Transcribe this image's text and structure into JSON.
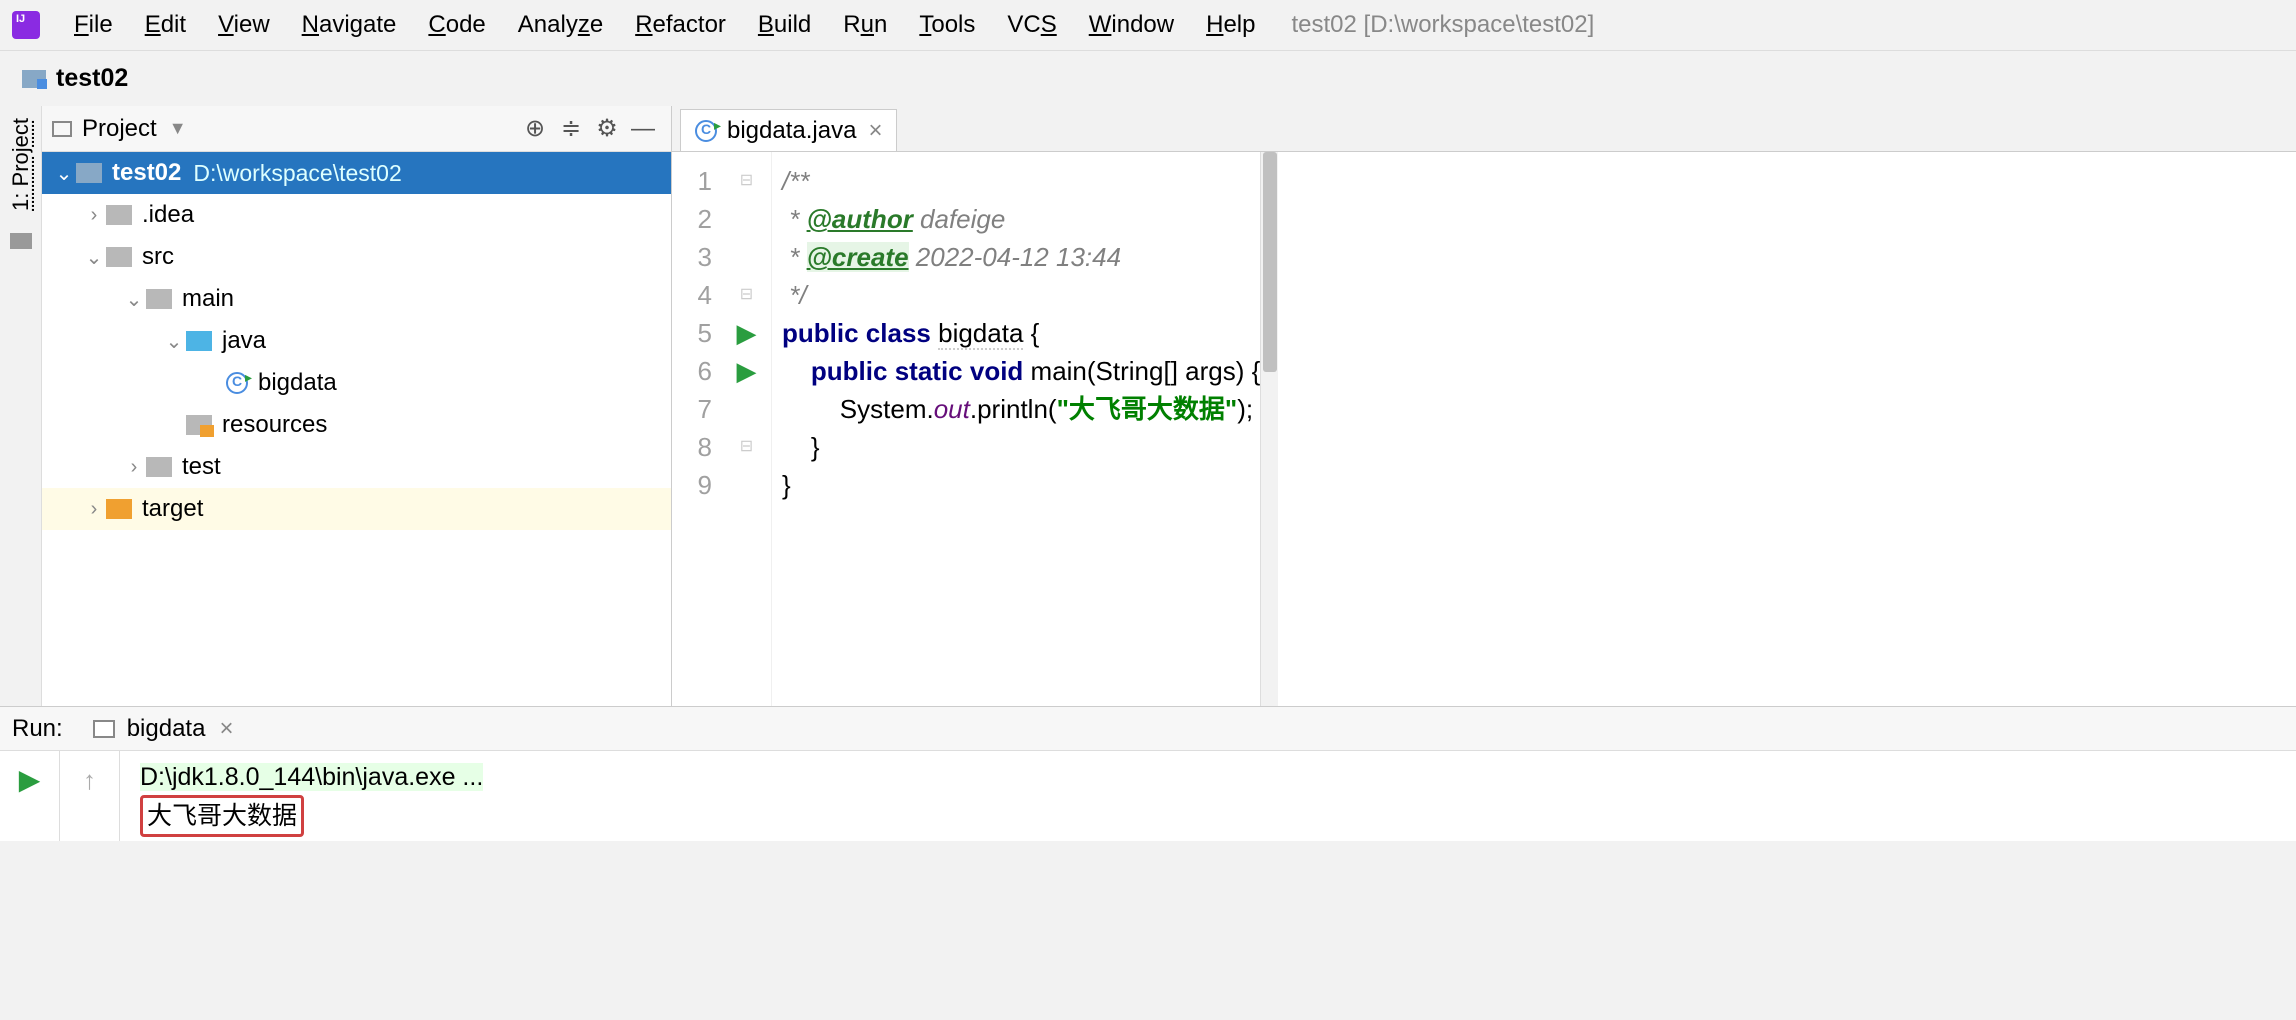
{
  "menu": {
    "items": [
      "File",
      "Edit",
      "View",
      "Navigate",
      "Code",
      "Analyze",
      "Refactor",
      "Build",
      "Run",
      "Tools",
      "VCS",
      "Window",
      "Help"
    ],
    "underlines": [
      "F",
      "E",
      "V",
      "N",
      "C",
      "z",
      "R",
      "B",
      "u",
      "T",
      "S",
      "W",
      "H"
    ],
    "project_path": "test02 [D:\\workspace\\test02]"
  },
  "breadcrumb": {
    "name": "test02"
  },
  "sidebar": {
    "tab": "1: Project"
  },
  "project": {
    "title": "Project",
    "root": {
      "name": "test02",
      "path": "D:\\workspace\\test02"
    },
    "nodes": {
      "idea": ".idea",
      "src": "src",
      "main": "main",
      "java": "java",
      "bigdata": "bigdata",
      "resources": "resources",
      "test": "test",
      "target": "target"
    }
  },
  "editor": {
    "tab_name": "bigdata.java",
    "lines": [
      "1",
      "2",
      "3",
      "4",
      "5",
      "6",
      "7",
      "8",
      "9"
    ],
    "code": {
      "l1": "/**",
      "l2_star": " * ",
      "l2_tag": "@author",
      "l2_val": " dafeige",
      "l3_star": " * ",
      "l3_tag": "@create",
      "l3_val": " 2022-04-12 13:44",
      "l4": " */",
      "l5_kw1": "public",
      "l5_kw2": "class",
      "l5_cls": "bigdata",
      "l5_brace": " {",
      "l6_kw1": "public",
      "l6_kw2": "static",
      "l6_kw3": "void",
      "l6_rest": " main(String[] args) {",
      "l7_a": "        System.",
      "l7_out": "out",
      "l7_b": ".println(",
      "l7_str": "\"大飞哥大数据\"",
      "l7_c": ");",
      "l8": "    }",
      "l9": "}"
    }
  },
  "run": {
    "label": "Run:",
    "config": "bigdata",
    "cmd": "D:\\jdk1.8.0_144\\bin\\java.exe ...",
    "output": "大飞哥大数据"
  }
}
